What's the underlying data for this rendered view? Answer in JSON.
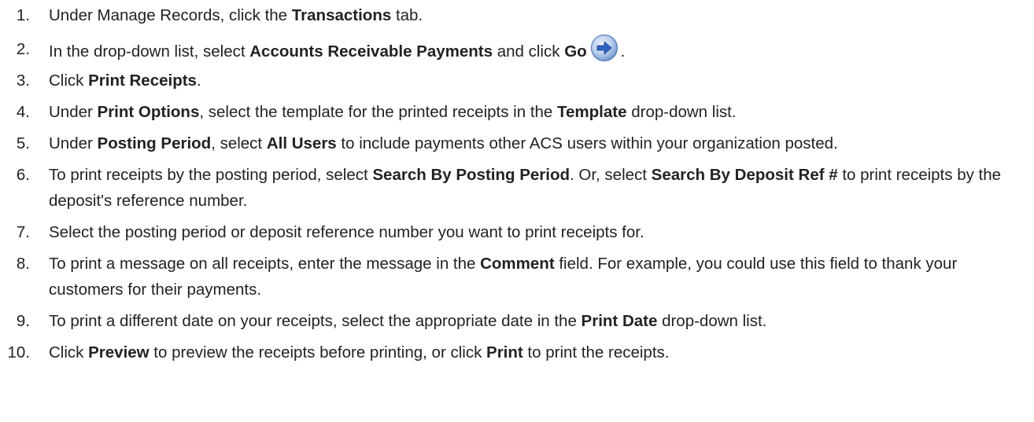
{
  "steps": [
    {
      "num": "1.",
      "segments": [
        {
          "t": "Under Manage Records, click the ",
          "b": false
        },
        {
          "t": "Transactions",
          "b": true
        },
        {
          "t": " tab.",
          "b": false
        }
      ]
    },
    {
      "num": "2.",
      "segments": [
        {
          "t": "In the drop-down list, select ",
          "b": false
        },
        {
          "t": "Accounts Receivable Payments",
          "b": true
        },
        {
          "t": " and click ",
          "b": false
        },
        {
          "t": "Go",
          "b": true
        },
        {
          "icon": "go-arrow-icon"
        },
        {
          "t": ".",
          "b": false
        }
      ]
    },
    {
      "num": "3.",
      "segments": [
        {
          "t": "Click ",
          "b": false
        },
        {
          "t": "Print Receipts",
          "b": true
        },
        {
          "t": ".",
          "b": false
        }
      ]
    },
    {
      "num": "4.",
      "segments": [
        {
          "t": "Under ",
          "b": false
        },
        {
          "t": "Print Options",
          "b": true
        },
        {
          "t": ", select the template for the printed receipts in the ",
          "b": false
        },
        {
          "t": "Template",
          "b": true
        },
        {
          "t": " drop-down list.",
          "b": false
        }
      ]
    },
    {
      "num": "5.",
      "segments": [
        {
          "t": "Under ",
          "b": false
        },
        {
          "t": "Posting Period",
          "b": true
        },
        {
          "t": ", select ",
          "b": false
        },
        {
          "t": "All Users",
          "b": true
        },
        {
          "t": " to include payments other ACS users within your organization posted.",
          "b": false
        }
      ]
    },
    {
      "num": "6.",
      "segments": [
        {
          "t": "To print receipts by the posting period, select ",
          "b": false
        },
        {
          "t": "Search By Posting Period",
          "b": true
        },
        {
          "t": ". Or, select ",
          "b": false
        },
        {
          "t": "Search By Deposit Ref #",
          "b": true
        },
        {
          "t": " to print receipts by the deposit's reference number.",
          "b": false
        }
      ]
    },
    {
      "num": "7.",
      "segments": [
        {
          "t": "Select the posting period or deposit reference number you want to print receipts for.",
          "b": false
        }
      ]
    },
    {
      "num": "8.",
      "segments": [
        {
          "t": "To print a message on all receipts, enter the message in the ",
          "b": false
        },
        {
          "t": "Comment",
          "b": true
        },
        {
          "t": " field. For example, you could use this field to thank your customers for their payments.",
          "b": false
        }
      ]
    },
    {
      "num": "9.",
      "segments": [
        {
          "t": "To print a different date on your receipts, select the appropriate date in the ",
          "b": false
        },
        {
          "t": "Print Date",
          "b": true
        },
        {
          "t": " drop-down list.",
          "b": false
        }
      ]
    },
    {
      "num": "10.",
      "segments": [
        {
          "t": "Click ",
          "b": false
        },
        {
          "t": "Preview",
          "b": true
        },
        {
          "t": " to preview the receipts before printing, or click ",
          "b": false
        },
        {
          "t": "Print",
          "b": true
        },
        {
          "t": " to print the receipts.",
          "b": false
        }
      ]
    }
  ],
  "colors": {
    "text": "#222222",
    "icon_outer": "#6a8fc8",
    "icon_inner": "#2f63c0",
    "icon_highlight": "#eaf2ff"
  }
}
